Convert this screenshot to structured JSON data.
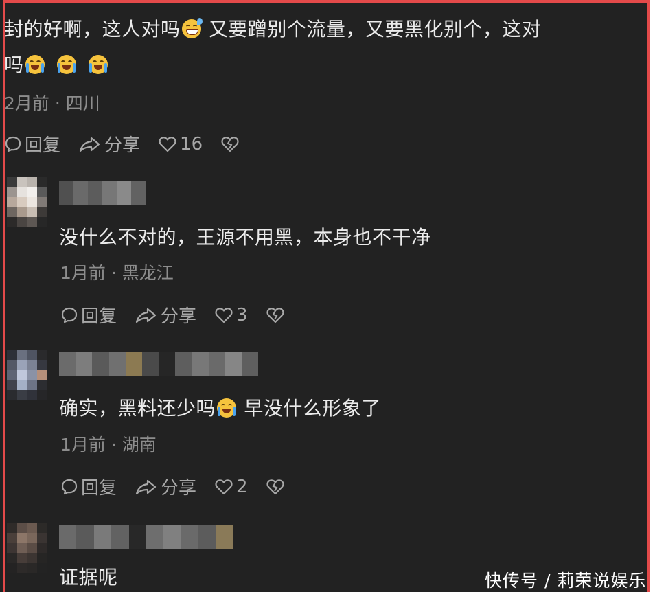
{
  "comments": [
    {
      "text_line1_a": "封的好啊，这人对吗",
      "text_line1_b": "又要蹭别个流量，又要黑化别个，这对",
      "text_line2_a": "吗",
      "meta": "2月前 · 四川",
      "actions": {
        "reply": "回复",
        "share": "分享",
        "likes": "16"
      }
    },
    {
      "text": "没什么不对的，王源不用黑，本身也不干净",
      "meta": "1月前 · 黑龙江",
      "actions": {
        "reply": "回复",
        "share": "分享",
        "likes": "3"
      }
    },
    {
      "text_a": "确实，黑料还少吗",
      "text_b": "早没什么形象了",
      "meta": "1月前 · 湖南",
      "actions": {
        "reply": "回复",
        "share": "分享",
        "likes": "2"
      }
    },
    {
      "text": "证据呢"
    }
  ],
  "icons": {
    "reply": "comment-bubble-icon",
    "share": "share-arrow-icon",
    "like": "heart-outline-icon",
    "dislike": "broken-heart-icon",
    "emoji_sweat": "grinning-sweat-emoji",
    "emoji_cry": "loudly-crying-emoji"
  },
  "watermark": "快传号 / 莉荣说娱乐",
  "colors": {
    "background": "#222222",
    "border": "#e34a4a",
    "text": "#ebebeb",
    "meta": "#8d8d8d",
    "actions": "#a8a8a8"
  }
}
